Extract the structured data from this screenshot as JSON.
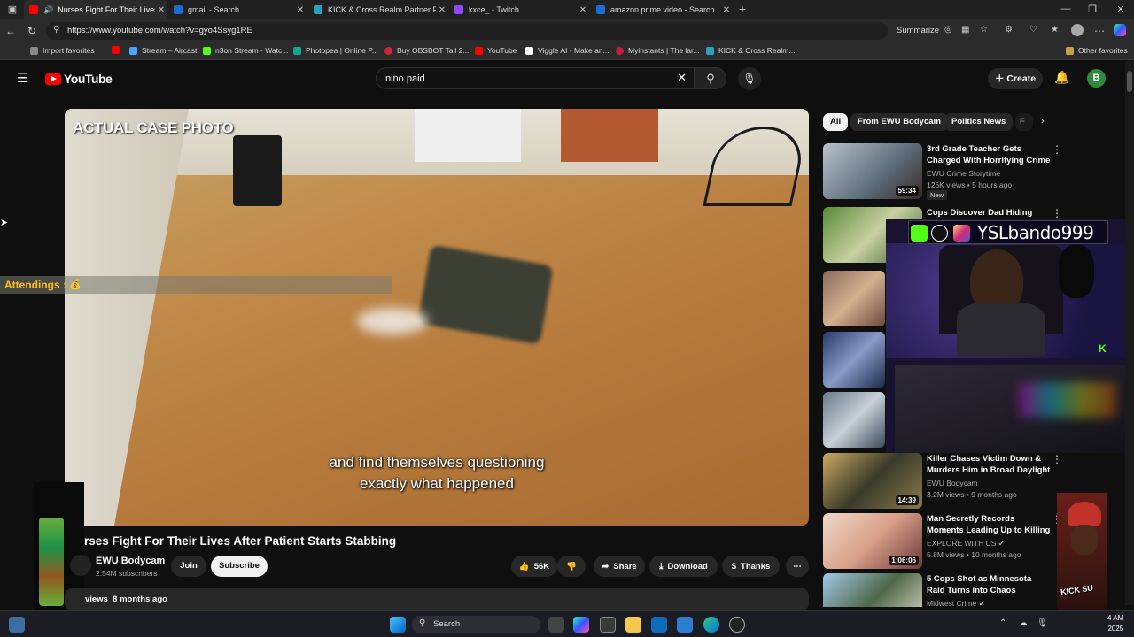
{
  "browser": {
    "tabs": [
      {
        "label": "Nurses Fight For Their Lives",
        "active": true,
        "color": "#ff0000"
      },
      {
        "label": "gmail - Search",
        "active": false,
        "color": "#1b6dd6"
      },
      {
        "label": "KICK & Cross Realm Partner Fast",
        "active": false,
        "color": "#2aa0c0"
      },
      {
        "label": "kxce_ - Twitch",
        "active": false,
        "color": "#9146ff"
      },
      {
        "label": "amazon prime video - Search",
        "active": false,
        "color": "#1b6dd6"
      }
    ],
    "new_tab": "+",
    "url": "https://www.youtube.com/watch?v=gyo4Ssyg1RE",
    "summarize": "Summarize",
    "bookmarks": [
      {
        "label": "Import favorites",
        "color": "#888888"
      },
      {
        "label": "",
        "color": "#ff0000"
      },
      {
        "label": "Stream – Aircast",
        "color": "#4aa3ff"
      },
      {
        "label": "n3on Stream - Watc...",
        "color": "#53fc18"
      },
      {
        "label": "Photopea | Online P...",
        "color": "#18a497"
      },
      {
        "label": "Buy OBSBOT Tail 2...",
        "color": "#d0243a"
      },
      {
        "label": "YouTube",
        "color": "#ff0000"
      },
      {
        "label": "Viggle AI - Make an...",
        "color": "#ffffff"
      },
      {
        "label": "Myinstants | The lar...",
        "color": "#c41e3a"
      },
      {
        "label": "KICK & Cross Realm...",
        "color": "#2aa0c0"
      }
    ],
    "other_favorites": "Other favorites"
  },
  "youtube": {
    "logo": "YouTube",
    "search_value": "nino paid",
    "create_label": "Create",
    "avatar_letter": "B"
  },
  "video": {
    "overlay_tag": "ACTUAL CASE PHOTO",
    "subtitle_line1": "and find themselves questioning",
    "subtitle_line2": "exactly what happened",
    "title": "rses Fight For Their Lives After Patient Starts Stabbing",
    "channel": "EWU Bodycam",
    "subscribers": "2.54M subscribers",
    "join_label": "Join",
    "subscribe_label": "Subscribe",
    "likes": "56K",
    "share_label": "Share",
    "download_label": "Download",
    "thanks_label": "Thanks",
    "desc_views": "views",
    "desc_date": "8 months ago"
  },
  "overlay": {
    "attendings_label": "Attendings :",
    "stream_handle": "YSLbando999",
    "figure_caption": "KICK SU"
  },
  "chips": [
    "All",
    "From EWU Bodycam",
    "Politics News",
    "F"
  ],
  "recommendations": [
    {
      "title": "3rd Grade Teacher Gets Charged With Horrifying Crime",
      "channel": "EWU Crime Storytime",
      "meta": "126K views • 5 hours ago",
      "duration": "59:34",
      "badge": "New"
    },
    {
      "title": "Cops Discover Dad Hiding",
      "channel": "",
      "meta": "",
      "duration": "",
      "badge": ""
    },
    {
      "title": "Killer Chases Victim Down & Murders Him in Broad Daylight",
      "channel": "EWU Bodycam",
      "meta": "3.2M views • 9 months ago",
      "duration": "14:39",
      "badge": ""
    },
    {
      "title": "Man Secretly Records Moments Leading Up to Killing",
      "channel": "EXPLORE WITH US",
      "meta": "5.8M views • 10 months ago",
      "duration": "1:06:06",
      "badge": ""
    },
    {
      "title": "5 Cops Shot as Minnesota Raid Turns into Chaos",
      "channel": "Midwest Crime",
      "meta": "",
      "duration": "",
      "badge": ""
    }
  ],
  "taskbar": {
    "search_placeholder": "Search",
    "clock_time": "4 AM",
    "clock_date": "2025"
  },
  "colors": {
    "yt_red": "#ff0000",
    "background": "#0f0f0f",
    "kick_green": "#53fc18"
  }
}
